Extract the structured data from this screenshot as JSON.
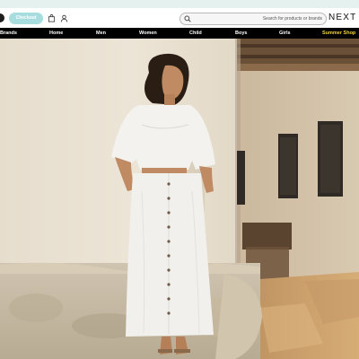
{
  "header": {
    "checkout_label": "Checkout",
    "search_placeholder": "Search for products or brands",
    "logo": "NEXT",
    "icons": [
      "whatsapp-icon",
      "bag-icon",
      "account-icon",
      "search-icon"
    ]
  },
  "nav": {
    "items": [
      {
        "label": "Brands"
      },
      {
        "label": "Home"
      },
      {
        "label": "Men"
      },
      {
        "label": "Women"
      },
      {
        "label": "Child"
      },
      {
        "label": "Boys"
      },
      {
        "label": "Girls"
      },
      {
        "label": "Summer Shop"
      }
    ],
    "highlight_color": "#f3d23c"
  },
  "colors": {
    "top_strip": "#e4f1ef",
    "checkout_bg": "#a8dde0",
    "nav_bg": "#000000"
  }
}
